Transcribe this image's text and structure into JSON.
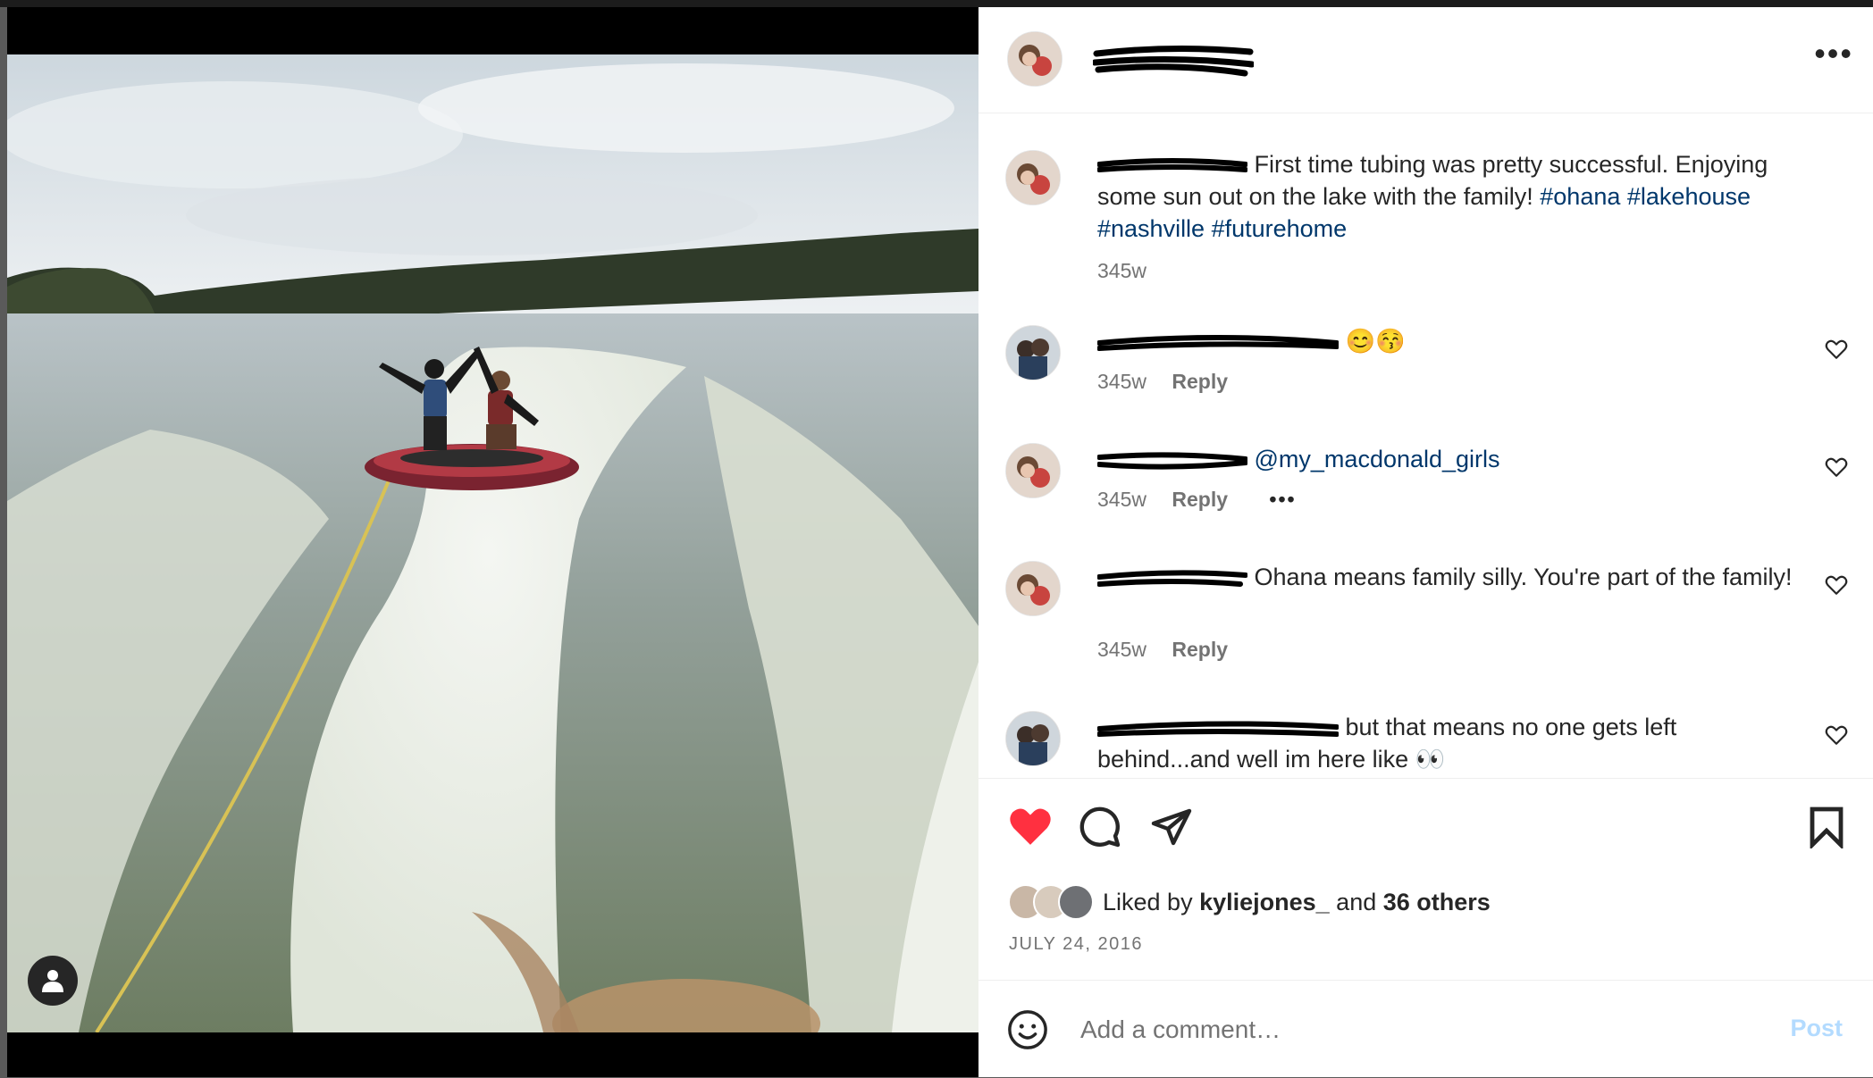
{
  "post": {
    "author_redacted": true,
    "caption": {
      "text_before": "First time tubing was pretty successful. Enjoying some sun out on the lake with the family! ",
      "hashtags": [
        "#ohana",
        "#lakehouse",
        "#nashville",
        "#futurehome"
      ],
      "age": "345w"
    },
    "more_icon": "more-horizontal-icon"
  },
  "comments": [
    {
      "text": "😊😚",
      "age": "345w",
      "reply": "Reply"
    },
    {
      "mention": "@my_macdonald_girls",
      "age": "345w",
      "reply": "Reply",
      "more": "•••"
    },
    {
      "text": "Ohana means family silly. You're part of the family!",
      "age": "345w",
      "reply": "Reply"
    },
    {
      "text": "but that means no one gets left behind...and well im here like 👀"
    }
  ],
  "actions": {
    "liked_prefix": "Liked by ",
    "liked_user": "kyliejones_",
    "liked_mid": " and ",
    "liked_others": "36 others",
    "date": "JULY 24, 2016",
    "liked": true,
    "accent": "#ff3040"
  },
  "add_comment": {
    "placeholder": "Add a comment…",
    "post_label": "Post"
  }
}
